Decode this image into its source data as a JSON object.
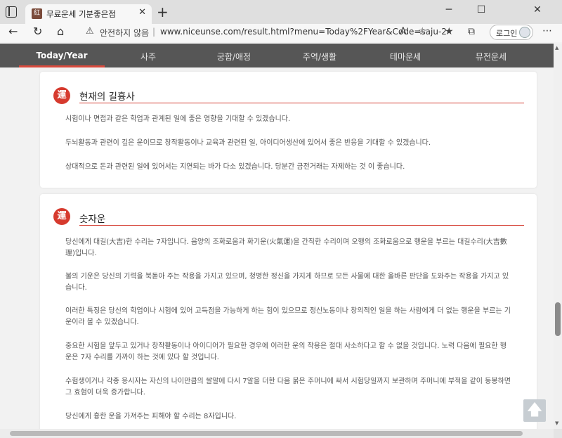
{
  "browser": {
    "tab_title": "무료운세 기분좋은점",
    "favicon_glyph": "紅",
    "new_tab": "+",
    "window_minimize": "─",
    "window_maximize": "☐",
    "window_close": "✕",
    "security_warning": "안전하지 않음",
    "url": "www.niceunse.com/result.html?menu=Today%2FYear&Code=saju-2",
    "login_label": "로그인",
    "icons": [
      "back-arrow-icon",
      "refresh-icon",
      "home-icon",
      "warning-icon",
      "read-aloud-icon",
      "add-favorite-icon",
      "favorites-icon",
      "collections-icon",
      "more-icon"
    ]
  },
  "site_nav": {
    "items": [
      "Today/Year",
      "사주",
      "궁합/애정",
      "주역/생활",
      "테마운세",
      "뮤전운세"
    ],
    "active_index": 0
  },
  "card1": {
    "emblem": "運",
    "title": "현재의 길흉사",
    "paragraphs": [
      "시험이나 면접과 같은 학업과 관계된 일에 좋은 영향을 기대할 수 있겠습니다.",
      "두뇌활동과 관련이 깊은 운이므로 창작활동이나 교육과 관련된 일, 아이디어생산에 있어서 좋은 반응을 기대할 수 있겠습니다.",
      "상대적으로 돈과 관련된 일에 있어서는 지연되는 바가 다소 있겠습니다. 당분간 금전거래는 자제하는 것 이 좋습니다."
    ]
  },
  "card2": {
    "emblem": "運",
    "title": "숫자운",
    "paragraphs": [
      "당신에게 대길(大吉)한 수리는 7자입니다. 음양의 조화로움과 화기운(火氣運)을 간직한 수리이며 오행의 조화로움으로 행운을 부르는 대길수리(大吉數理)입니다.",
      "불의 기운은 당신의 기력을 북돋아 주는 작용을 가지고 있으며, 청명한 정신을 가지게 하므로 모든 사물에 대한 올바른 판단을 도와주는 작용을 가지고 있습니다.",
      "이러한 특징은 당신의 학업이나 시험에 있어 고득점을 가능하게 하는 힘이 있으므로 정신노동이나 창의적인 일을 하는 사람에게 더 없는 행운을 부르는 기운이라 볼 수 있겠습니다.",
      "중요한 시험을 앞두고 있거나 창작활동이나 아이디어가 필요한 경우에 이러한 운의 작용은 절대 사소하다고 할 수 없을 것입니다. 노력 다음에 필요한 행운은 7자 수리를 가까이 하는 것에 있다 할 것입니다.",
      "수험생이거나 각종 응시자는 자신의 나이만큼의 쌀알에 다시 7알을 더한 다음 붉은 주머니에 싸서 시험당일까지 보관하며 주머니에 부적을 같이 동봉하면 그 효험이 더욱 증가합니다.",
      "당신에게 흉한 운을 가져주는 피해야 할 수리는 8자입니다."
    ]
  },
  "scroll_top_glyph": "🡅",
  "colors": {
    "accent": "#d94a3d",
    "nav_bg": "#565656"
  }
}
